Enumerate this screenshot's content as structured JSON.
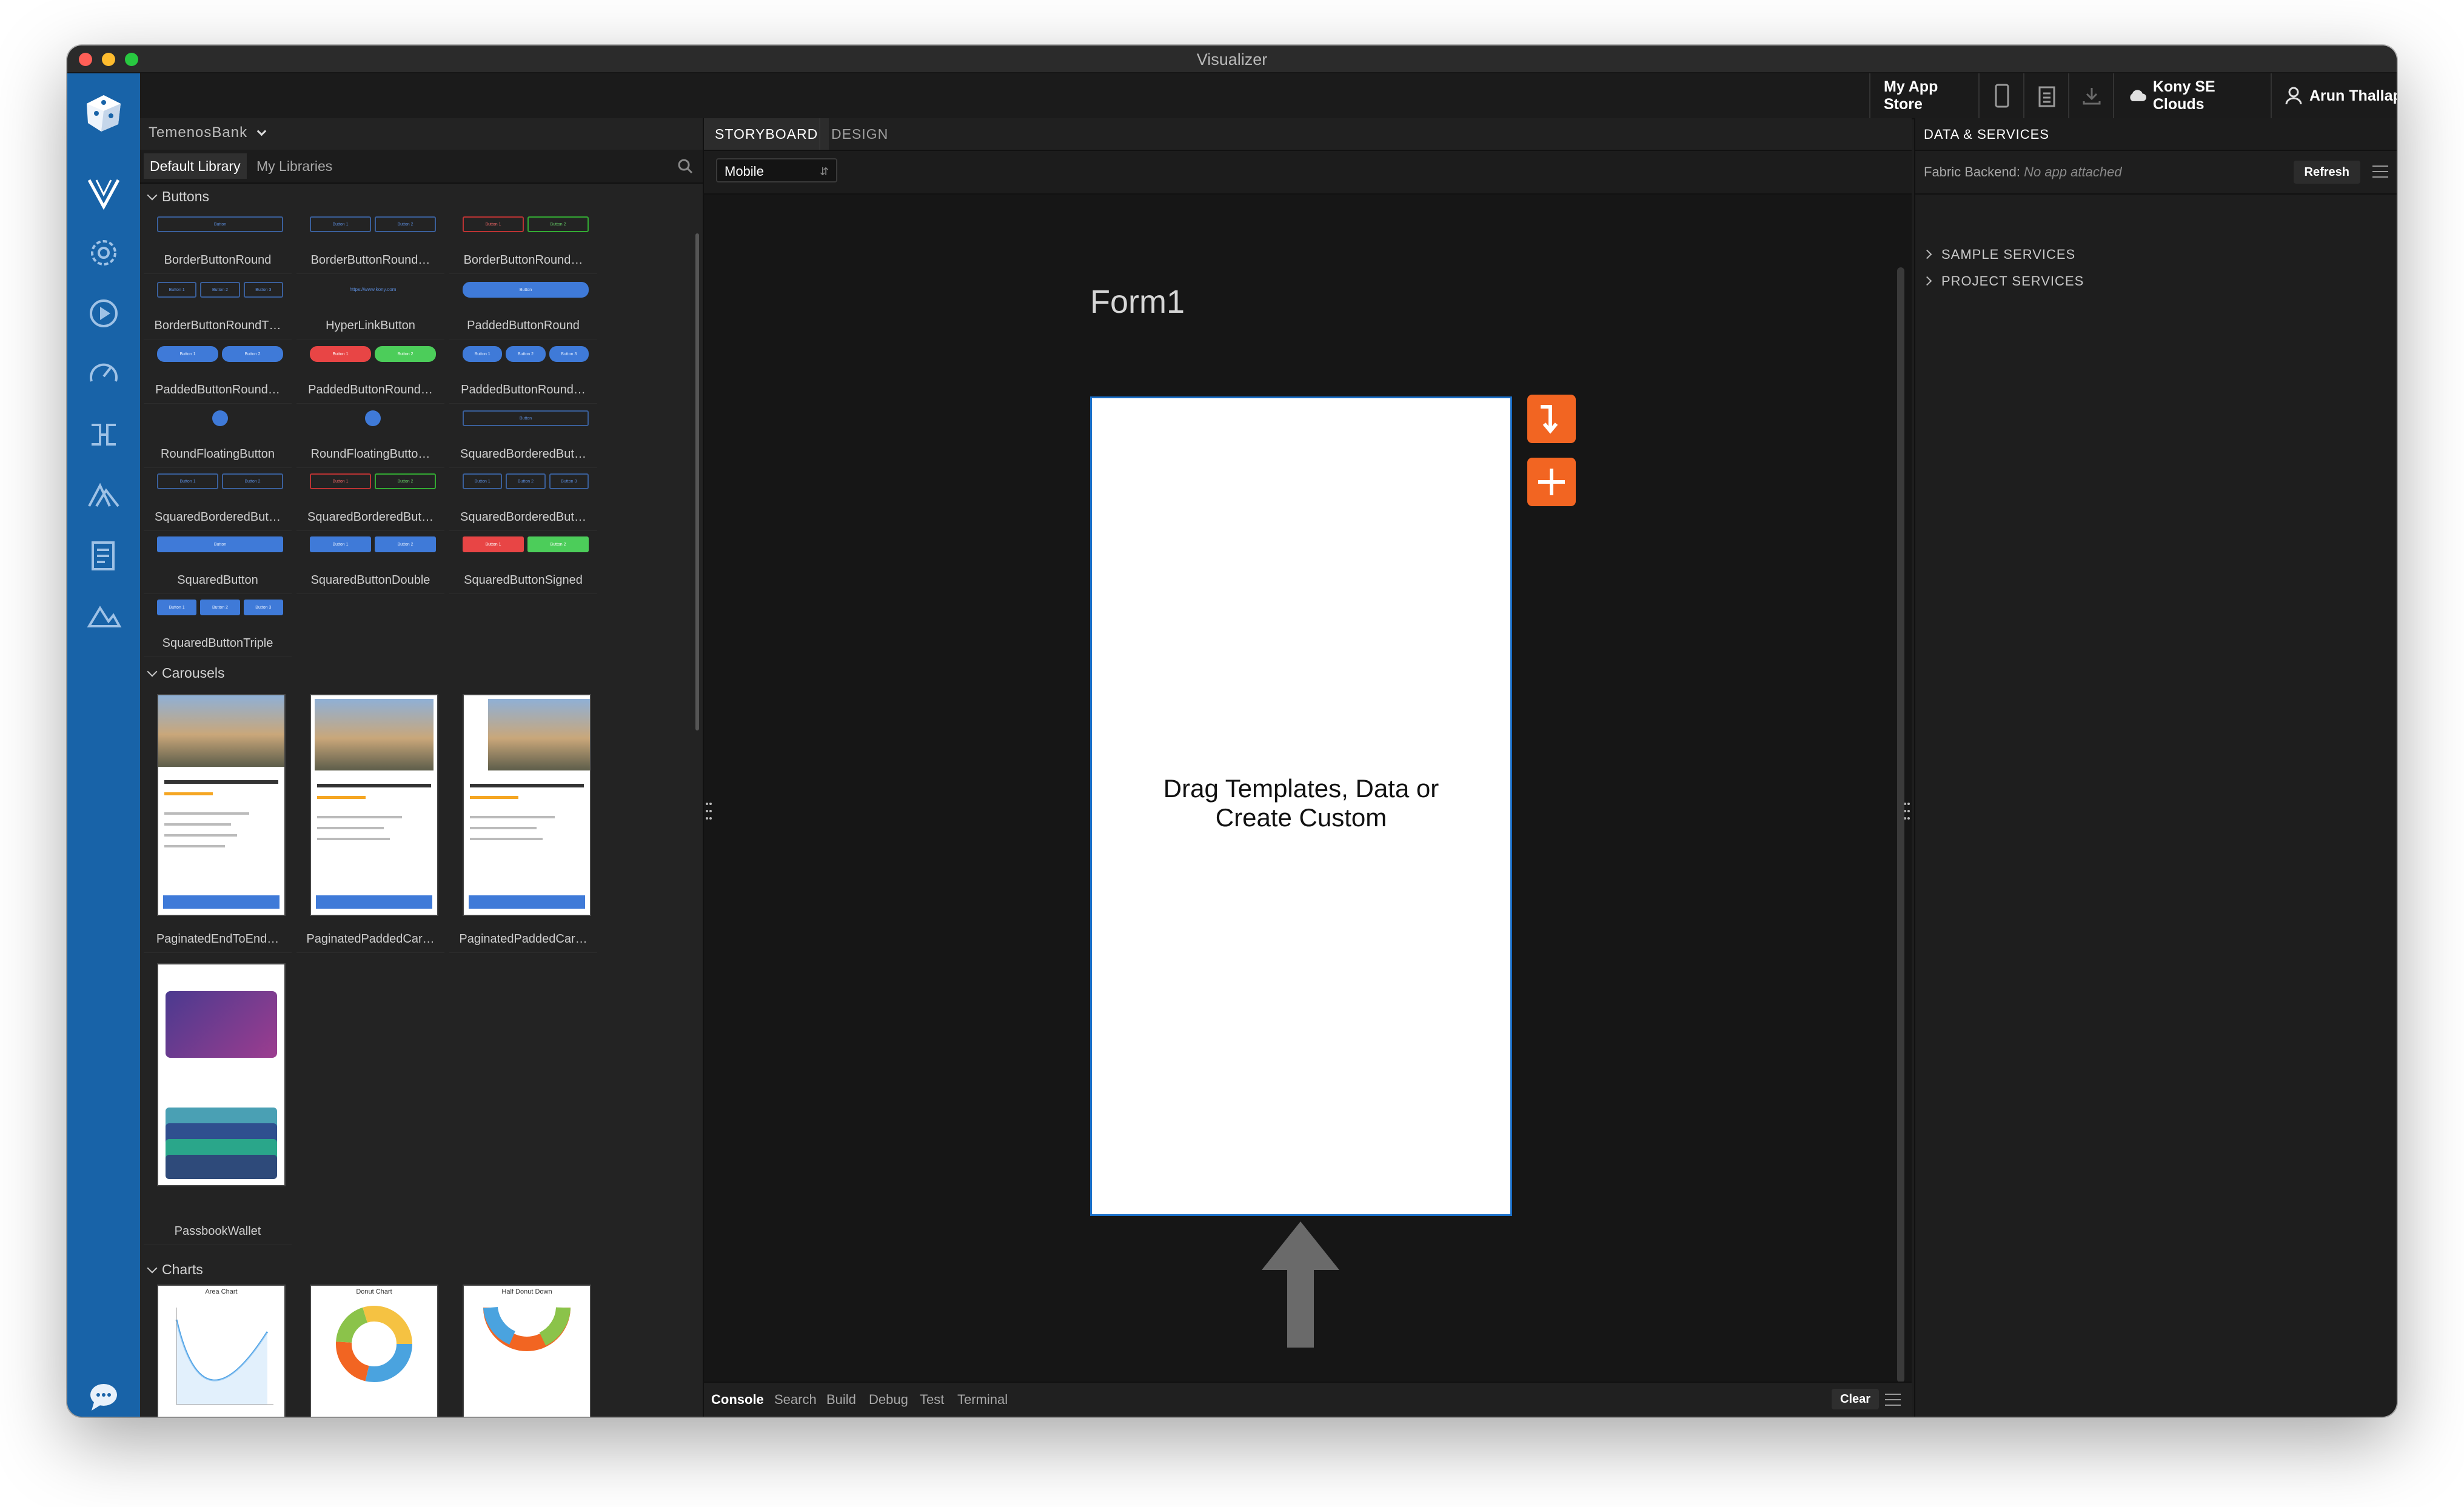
{
  "window": {
    "title": "Visualizer"
  },
  "toolbar": {
    "app_store_label": "My App Store",
    "cloud_label": "Kony SE Clouds",
    "user_label": "Arun Thallapelly"
  },
  "library": {
    "project_name": "TemenosBank",
    "tabs": [
      "Default Library",
      "My Libraries"
    ],
    "sections": {
      "buttons": "Buttons",
      "carousels": "Carousels",
      "charts": "Charts"
    },
    "button_items": [
      "BorderButtonRound",
      "BorderButtonRound…",
      "BorderButtonRound…",
      "BorderButtonRoundT…",
      "HyperLinkButton",
      "PaddedButtonRound",
      "PaddedButtonRound…",
      "PaddedButtonRound…",
      "PaddedButtonRound…",
      "RoundFloatingButton",
      "RoundFloatingButto…",
      "SquaredBorderedBut…",
      "SquaredBorderedBut…",
      "SquaredBorderedBut…",
      "SquaredBorderedBut…",
      "SquaredButton",
      "SquaredButtonDouble",
      "SquaredButtonSigned",
      "SquaredButtonTriple"
    ],
    "carousel_items": [
      "PaginatedEndToEnd…",
      "PaginatedPaddedCar…",
      "PaginatedPaddedCar…",
      "PassbookWallet"
    ],
    "chart_thumbs": [
      "Area Chart",
      "Donut Chart",
      "Half Donut Down"
    ]
  },
  "canvas": {
    "tabs": [
      "STORYBOARD",
      "DESIGN"
    ],
    "device_select": "Mobile",
    "form_title": "Form1",
    "drop_hint": "Drag Templates, Data or Create Custom"
  },
  "console": {
    "tabs": [
      "Console",
      "Search",
      "Build",
      "Debug",
      "Test",
      "Terminal"
    ],
    "clear_label": "Clear"
  },
  "data_services": {
    "title": "DATA & SERVICES",
    "fabric_label": "Fabric Backend:",
    "fabric_value": "No app attached",
    "refresh_label": "Refresh",
    "rows": [
      "SAMPLE SERVICES",
      "PROJECT SERVICES"
    ]
  },
  "colors": {
    "accent_orange": "#f26522",
    "rail_blue": "#1863a8",
    "selection_blue": "#1a6fc8"
  }
}
